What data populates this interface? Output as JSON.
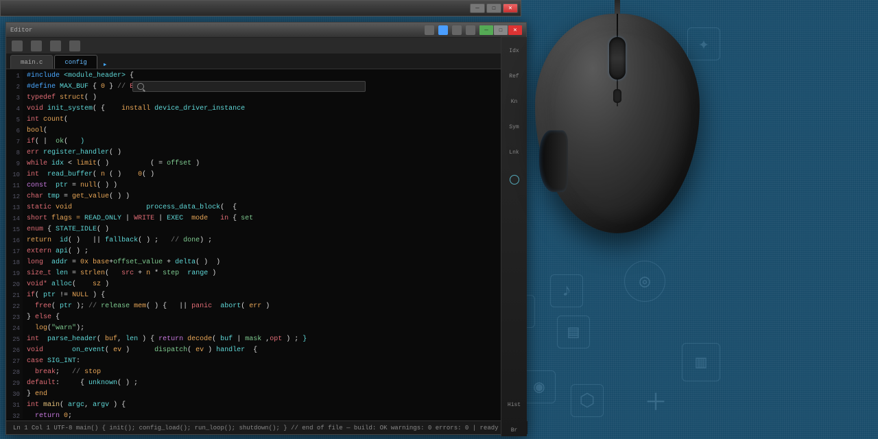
{
  "topWindow": {
    "minimize": "—",
    "maximize": "☐",
    "close": "✕"
  },
  "editor": {
    "title": "Editor",
    "winbtns": {
      "minimize": "—",
      "maximize": "☐",
      "close": "✕"
    },
    "tabs": [
      {
        "label": "main.c",
        "active": false
      },
      {
        "label": "config",
        "active": true
      }
    ],
    "search_placeholder": "",
    "rightPanel": [
      "Idx",
      "Ref",
      "Kn",
      "Sym",
      "Lnk",
      "",
      "",
      "",
      "",
      "Hist",
      "Br"
    ],
    "lines": [
      {
        "n": "1",
        "tokens": [
          {
            "t": "#include ",
            "c": "kw-blue"
          },
          {
            "t": "<module_header>",
            "c": "kw-cyan"
          },
          {
            "t": " {",
            "c": "kw-white"
          }
        ]
      },
      {
        "n": "2",
        "tokens": [
          {
            "t": "#define ",
            "c": "kw-blue"
          },
          {
            "t": "MAX_BUF",
            "c": "kw-cyan"
          },
          {
            "t": " { ",
            "c": "kw-white"
          },
          {
            "t": "0",
            "c": "kw-orange"
          },
          {
            "t": " } ",
            "c": "kw-white"
          },
          {
            "t": "// ",
            "c": "kw-grey"
          },
          {
            "t": "EOL:",
            "c": "kw-red"
          }
        ]
      },
      {
        "n": "3",
        "tokens": [
          {
            "t": "typedef ",
            "c": "kw-red"
          },
          {
            "t": "struct",
            "c": "kw-orange"
          },
          {
            "t": "(",
            "c": "kw-white"
          },
          {
            "t": " )",
            "c": "kw-white"
          }
        ]
      },
      {
        "n": "4",
        "tokens": [
          {
            "t": "void ",
            "c": "kw-red"
          },
          {
            "t": "init_system",
            "c": "kw-cyan"
          },
          {
            "t": "( ",
            "c": "kw-white"
          },
          {
            "t": "{    ",
            "c": "kw-white"
          },
          {
            "t": "install ",
            "c": "kw-orange"
          },
          {
            "t": "device_driver_instance",
            "c": "kw-cyan"
          }
        ]
      },
      {
        "n": "5",
        "tokens": [
          {
            "t": "int ",
            "c": "kw-red"
          },
          {
            "t": "count",
            "c": "kw-orange"
          },
          {
            "t": "(",
            "c": "kw-white"
          }
        ]
      },
      {
        "n": "6",
        "tokens": [
          {
            "t": "bool",
            "c": "kw-orange"
          },
          {
            "t": "(",
            "c": "kw-white"
          }
        ]
      },
      {
        "n": "7",
        "tokens": [
          {
            "t": "if",
            "c": "kw-red"
          },
          {
            "t": "( ",
            "c": "kw-white"
          },
          {
            "t": "| ",
            "c": "kw-white"
          },
          {
            "t": " ",
            "c": "kw-white"
          },
          {
            "t": "ok",
            "c": "kw-green"
          },
          {
            "t": "( ",
            "c": "kw-white"
          },
          {
            "t": "  )",
            "c": "kw-cyan"
          }
        ]
      },
      {
        "n": "8",
        "tokens": [
          {
            "t": "err ",
            "c": "kw-red"
          },
          {
            "t": "register_handler",
            "c": "kw-cyan"
          },
          {
            "t": "( )",
            "c": "kw-white"
          }
        ]
      },
      {
        "n": "9",
        "tokens": [
          {
            "t": "while ",
            "c": "kw-red"
          },
          {
            "t": "idx ",
            "c": "kw-cyan"
          },
          {
            "t": "< ",
            "c": "kw-white"
          },
          {
            "t": "limit",
            "c": "kw-orange"
          },
          {
            "t": "( )          ",
            "c": "kw-white"
          },
          {
            "t": "( = ",
            "c": "kw-white"
          },
          {
            "t": "offset",
            "c": "kw-green"
          },
          {
            "t": " )",
            "c": "kw-white"
          }
        ]
      },
      {
        "n": "10",
        "tokens": [
          {
            "t": "int  ",
            "c": "kw-red"
          },
          {
            "t": "read_buffer",
            "c": "kw-cyan"
          },
          {
            "t": "( ",
            "c": "kw-white"
          },
          {
            "t": "n",
            "c": "kw-orange"
          },
          {
            "t": " ( )    ",
            "c": "kw-white"
          },
          {
            "t": "0",
            "c": "kw-orange"
          },
          {
            "t": "( )",
            "c": "kw-white"
          }
        ]
      },
      {
        "n": "11",
        "tokens": [
          {
            "t": "const  ",
            "c": "kw-purple"
          },
          {
            "t": "ptr ",
            "c": "kw-cyan"
          },
          {
            "t": "= ",
            "c": "kw-white"
          },
          {
            "t": "null",
            "c": "kw-orange"
          },
          {
            "t": "( ) )",
            "c": "kw-white"
          }
        ]
      },
      {
        "n": "12",
        "tokens": [
          {
            "t": "char ",
            "c": "kw-red"
          },
          {
            "t": "tmp ",
            "c": "kw-cyan"
          },
          {
            "t": "= ",
            "c": "kw-white"
          },
          {
            "t": "get_value",
            "c": "kw-orange"
          },
          {
            "t": "( ) )",
            "c": "kw-white"
          }
        ]
      },
      {
        "n": "13",
        "tokens": [
          {
            "t": "static ",
            "c": "kw-red"
          },
          {
            "t": "void",
            "c": "kw-orange"
          },
          {
            "t": "                  ",
            "c": "kw-white"
          },
          {
            "t": "process_data_block",
            "c": "kw-cyan"
          },
          {
            "t": "(  {",
            "c": "kw-white"
          }
        ]
      },
      {
        "n": "14",
        "tokens": [
          {
            "t": "short ",
            "c": "kw-red"
          },
          {
            "t": "flags = ",
            "c": "kw-orange"
          },
          {
            "t": "READ_ONLY ",
            "c": "kw-cyan"
          },
          {
            "t": "| ",
            "c": "kw-white"
          },
          {
            "t": "WRITE ",
            "c": "kw-red"
          },
          {
            "t": "| ",
            "c": "kw-white"
          },
          {
            "t": "EXEC  ",
            "c": "kw-cyan"
          },
          {
            "t": "mode   ",
            "c": "kw-orange"
          },
          {
            "t": "in",
            "c": "kw-red"
          },
          {
            "t": " { ",
            "c": "kw-white"
          },
          {
            "t": "set",
            "c": "kw-green"
          }
        ]
      },
      {
        "n": "15",
        "tokens": [
          {
            "t": "enum ",
            "c": "kw-red"
          },
          {
            "t": "{ ",
            "c": "kw-white"
          },
          {
            "t": "STATE_IDLE",
            "c": "kw-cyan"
          },
          {
            "t": "( )",
            "c": "kw-white"
          }
        ]
      },
      {
        "n": "16",
        "tokens": [
          {
            "t": "return  ",
            "c": "kw-orange"
          },
          {
            "t": "id",
            "c": "kw-cyan"
          },
          {
            "t": "( )   ",
            "c": "kw-white"
          },
          {
            "t": "|| ",
            "c": "kw-white"
          },
          {
            "t": "fallback",
            "c": "kw-cyan"
          },
          {
            "t": "( ) ;   ",
            "c": "kw-white"
          },
          {
            "t": "// ",
            "c": "kw-grey"
          },
          {
            "t": "done",
            "c": "kw-green"
          },
          {
            "t": ") ;",
            "c": "kw-white"
          }
        ]
      },
      {
        "n": "17",
        "tokens": [
          {
            "t": "extern ",
            "c": "kw-red"
          },
          {
            "t": "api",
            "c": "kw-cyan"
          },
          {
            "t": "( ) ;",
            "c": "kw-white"
          }
        ]
      },
      {
        "n": "18",
        "tokens": [
          {
            "t": "long  ",
            "c": "kw-red"
          },
          {
            "t": "addr ",
            "c": "kw-cyan"
          },
          {
            "t": "= ",
            "c": "kw-white"
          },
          {
            "t": "0x",
            "c": "kw-orange"
          },
          {
            "t": " ",
            "c": "kw-white"
          },
          {
            "t": "base",
            "c": "kw-orange"
          },
          {
            "t": "+",
            "c": "kw-white"
          },
          {
            "t": "offset_value",
            "c": "kw-green"
          },
          {
            "t": " + ",
            "c": "kw-white"
          },
          {
            "t": "delta",
            "c": "kw-cyan"
          },
          {
            "t": "( )  )",
            "c": "kw-white"
          }
        ]
      },
      {
        "n": "19",
        "tokens": [
          {
            "t": "size_t ",
            "c": "kw-red"
          },
          {
            "t": "len ",
            "c": "kw-cyan"
          },
          {
            "t": "= ",
            "c": "kw-white"
          },
          {
            "t": "strlen",
            "c": "kw-orange"
          },
          {
            "t": "(   ",
            "c": "kw-white"
          },
          {
            "t": "src",
            "c": "kw-red"
          },
          {
            "t": " ",
            "c": "kw-white"
          },
          {
            "t": "+ ",
            "c": "kw-white"
          },
          {
            "t": "n ",
            "c": "kw-orange"
          },
          {
            "t": "* ",
            "c": "kw-white"
          },
          {
            "t": "step",
            "c": "kw-green"
          },
          {
            "t": "  ",
            "c": "kw-white"
          },
          {
            "t": "range",
            "c": "kw-cyan"
          },
          {
            "t": " )",
            "c": "kw-white"
          }
        ]
      },
      {
        "n": "20",
        "tokens": [
          {
            "t": "void* ",
            "c": "kw-red"
          },
          {
            "t": "alloc",
            "c": "kw-cyan"
          },
          {
            "t": "(    ",
            "c": "kw-white"
          },
          {
            "t": "sz",
            "c": "kw-orange"
          },
          {
            "t": " )",
            "c": "kw-white"
          }
        ]
      },
      {
        "n": "21",
        "tokens": [
          {
            "t": "if",
            "c": "kw-red"
          },
          {
            "t": "( ",
            "c": "kw-white"
          },
          {
            "t": "ptr ",
            "c": "kw-cyan"
          },
          {
            "t": "!= ",
            "c": "kw-white"
          },
          {
            "t": "NULL",
            "c": "kw-orange"
          },
          {
            "t": " ) {",
            "c": "kw-white"
          }
        ]
      },
      {
        "n": "22",
        "tokens": [
          {
            "t": "  ",
            "c": "kw-white"
          },
          {
            "t": "free",
            "c": "kw-red"
          },
          {
            "t": "( ",
            "c": "kw-white"
          },
          {
            "t": "ptr ",
            "c": "kw-cyan"
          },
          {
            "t": "); ",
            "c": "kw-white"
          },
          {
            "t": "// ",
            "c": "kw-grey"
          },
          {
            "t": "release",
            "c": "kw-green"
          },
          {
            "t": " ",
            "c": "kw-white"
          },
          {
            "t": "mem",
            "c": "kw-orange"
          },
          {
            "t": "( ) {   ",
            "c": "kw-white"
          },
          {
            "t": "|| ",
            "c": "kw-white"
          },
          {
            "t": "panic",
            "c": "kw-red"
          },
          {
            "t": "  ",
            "c": "kw-white"
          },
          {
            "t": "abort",
            "c": "kw-cyan"
          },
          {
            "t": "( ",
            "c": "kw-white"
          },
          {
            "t": "err",
            "c": "kw-orange"
          },
          {
            "t": " )",
            "c": "kw-white"
          }
        ]
      },
      {
        "n": "23",
        "tokens": [
          {
            "t": "} ",
            "c": "kw-white"
          },
          {
            "t": "else",
            "c": "kw-red"
          },
          {
            "t": " {",
            "c": "kw-white"
          }
        ]
      },
      {
        "n": "24",
        "tokens": [
          {
            "t": "  ",
            "c": "kw-white"
          },
          {
            "t": "log",
            "c": "kw-orange"
          },
          {
            "t": "(",
            "c": "kw-white"
          },
          {
            "t": "\"warn\"",
            "c": "kw-green"
          },
          {
            "t": ");",
            "c": "kw-white"
          }
        ]
      },
      {
        "n": "25",
        "tokens": [
          {
            "t": "int  ",
            "c": "kw-red"
          },
          {
            "t": "parse_header",
            "c": "kw-cyan"
          },
          {
            "t": "( ",
            "c": "kw-white"
          },
          {
            "t": "buf",
            "c": "kw-orange"
          },
          {
            "t": ", ",
            "c": "kw-white"
          },
          {
            "t": "len",
            "c": "kw-cyan"
          },
          {
            "t": " ) { ",
            "c": "kw-white"
          },
          {
            "t": "return ",
            "c": "kw-purple"
          },
          {
            "t": "decode",
            "c": "kw-orange"
          },
          {
            "t": "( ",
            "c": "kw-white"
          },
          {
            "t": "buf",
            "c": "kw-cyan"
          },
          {
            "t": " ",
            "c": "kw-white"
          },
          {
            "t": "| ",
            "c": "kw-white"
          },
          {
            "t": "mask",
            "c": "kw-green"
          },
          {
            "t": " ",
            "c": "kw-white"
          },
          {
            "t": ",",
            "c": "kw-white"
          },
          {
            "t": "opt",
            "c": "kw-red"
          },
          {
            "t": " ) ",
            "c": "kw-white"
          },
          {
            "t": ";",
            "c": "kw-white"
          },
          {
            "t": " }",
            "c": "kw-cyan"
          }
        ]
      },
      {
        "n": "26",
        "tokens": [
          {
            "t": "void",
            "c": "kw-red"
          },
          {
            "t": "       ",
            "c": "kw-white"
          },
          {
            "t": "on_event",
            "c": "kw-cyan"
          },
          {
            "t": "( ",
            "c": "kw-white"
          },
          {
            "t": "ev",
            "c": "kw-orange"
          },
          {
            "t": " )      ",
            "c": "kw-white"
          },
          {
            "t": "dispatch",
            "c": "kw-green"
          },
          {
            "t": "( ",
            "c": "kw-white"
          },
          {
            "t": "ev",
            "c": "kw-orange"
          },
          {
            "t": " ) ",
            "c": "kw-white"
          },
          {
            "t": "handler",
            "c": "kw-cyan"
          },
          {
            "t": "  {",
            "c": "kw-white"
          }
        ]
      },
      {
        "n": "27",
        "tokens": [
          {
            "t": "case ",
            "c": "kw-red"
          },
          {
            "t": "SIG_INT",
            "c": "kw-cyan"
          },
          {
            "t": ":",
            "c": "kw-white"
          }
        ]
      },
      {
        "n": "28",
        "tokens": [
          {
            "t": "  ",
            "c": "kw-white"
          },
          {
            "t": "break",
            "c": "kw-red"
          },
          {
            "t": ";   ",
            "c": "kw-white"
          },
          {
            "t": "// ",
            "c": "kw-grey"
          },
          {
            "t": "stop",
            "c": "kw-orange"
          }
        ]
      },
      {
        "n": "29",
        "tokens": [
          {
            "t": "default",
            "c": "kw-red"
          },
          {
            "t": ":     { ",
            "c": "kw-white"
          },
          {
            "t": "unknown",
            "c": "kw-cyan"
          },
          {
            "t": "( ) ;",
            "c": "kw-white"
          }
        ]
      },
      {
        "n": "30",
        "tokens": [
          {
            "t": "} ",
            "c": "kw-white"
          },
          {
            "t": "end",
            "c": "kw-orange"
          }
        ]
      },
      {
        "n": "31",
        "tokens": [
          {
            "t": "int ",
            "c": "kw-red"
          },
          {
            "t": "main",
            "c": "kw-yellow"
          },
          {
            "t": "( ",
            "c": "kw-white"
          },
          {
            "t": "argc",
            "c": "kw-cyan"
          },
          {
            "t": ", ",
            "c": "kw-white"
          },
          {
            "t": "argv",
            "c": "kw-cyan"
          },
          {
            "t": " ) {",
            "c": "kw-white"
          }
        ]
      },
      {
        "n": "32",
        "tokens": [
          {
            "t": "  ",
            "c": "kw-white"
          },
          {
            "t": "return ",
            "c": "kw-purple"
          },
          {
            "t": "0",
            "c": "kw-orange"
          },
          {
            "t": ";",
            "c": "kw-white"
          }
        ]
      }
    ],
    "statusbar": "  Ln 1  Col 1   UTF-8   main() { init(); config_load(); run_loop(); shutdown(); } // end of file — build: OK  warnings: 0  errors: 0  | ready"
  }
}
